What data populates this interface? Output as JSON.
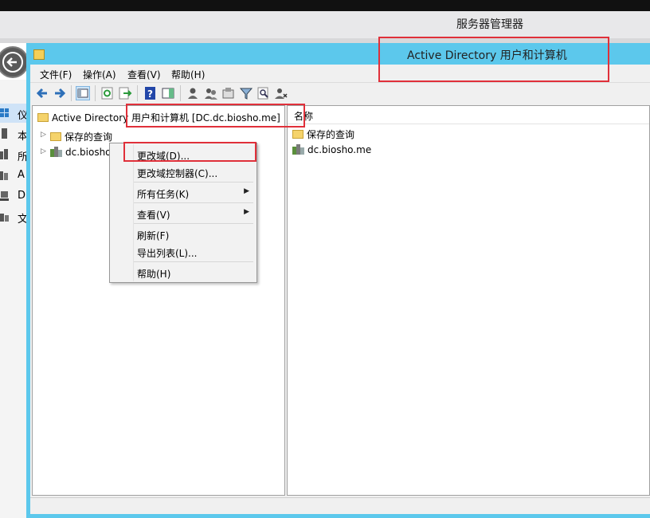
{
  "server_manager": {
    "title": "服务器管理器",
    "nav_items": [
      {
        "label": "仪",
        "icon": "dashboard-icon"
      },
      {
        "label": "本",
        "icon": "local-server-icon"
      },
      {
        "label": "所",
        "icon": "all-servers-icon"
      },
      {
        "label": "A",
        "icon": "ad-ds-icon"
      },
      {
        "label": "D",
        "icon": "dns-icon"
      },
      {
        "label": "文",
        "icon": "file-services-icon"
      }
    ]
  },
  "aduc": {
    "window_title": "Active Directory 用户和计算机",
    "menu": [
      "文件(F)",
      "操作(A)",
      "查看(V)",
      "帮助(H)"
    ],
    "tree": {
      "root": "Active Directory 用户和计算机 [DC.dc.biosho.me]",
      "items": [
        "保存的查询",
        "dc.biosho.me"
      ]
    },
    "list": {
      "column": "名称",
      "items": [
        "保存的查询",
        "dc.biosho.me"
      ]
    },
    "context_menu": [
      {
        "label": "更改域(D)...",
        "submenu": false
      },
      {
        "label": "更改域控制器(C)...",
        "submenu": false
      },
      {
        "label": "所有任务(K)",
        "submenu": true
      },
      {
        "label": "查看(V)",
        "submenu": true
      },
      {
        "label": "刷新(F)",
        "submenu": false
      },
      {
        "label": "导出列表(L)...",
        "submenu": false
      },
      {
        "label": "帮助(H)",
        "submenu": false
      }
    ]
  },
  "colors": {
    "window_frame": "#5cc8ec",
    "highlight_box": "#e0303a"
  }
}
